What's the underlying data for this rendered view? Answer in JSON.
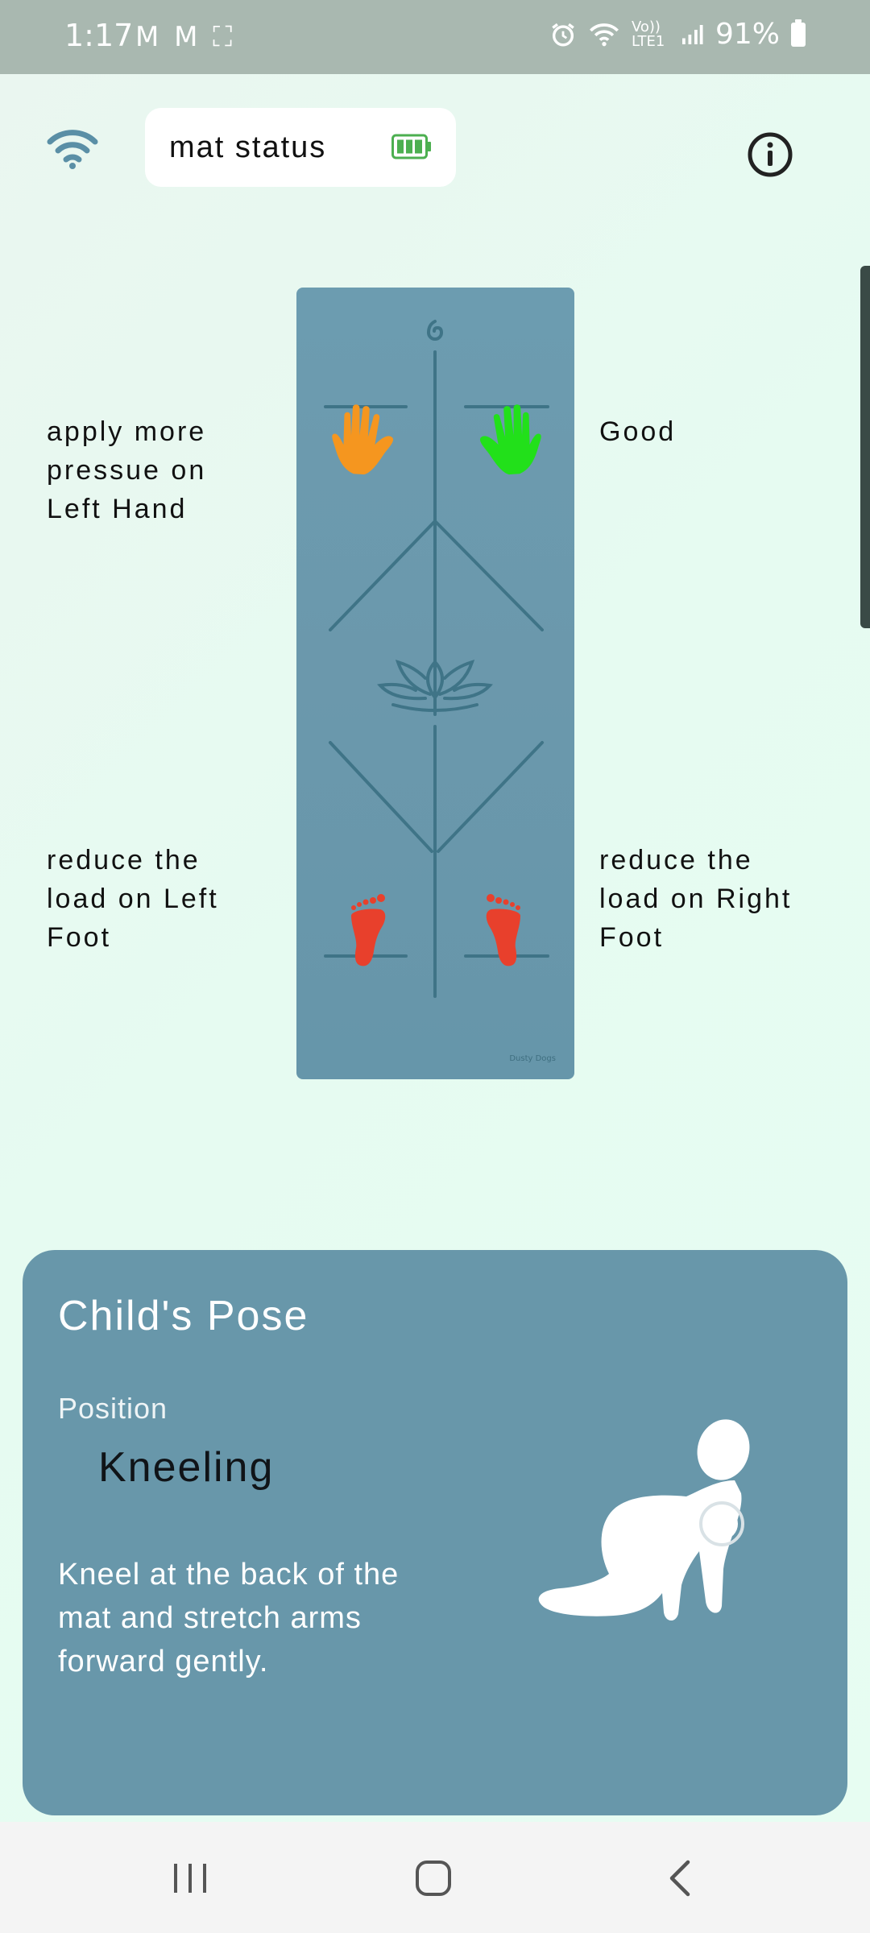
{
  "status_bar": {
    "time": "1:17",
    "left_icons": "M M ⛶",
    "volte": "Vo)) LTE1",
    "battery_pct": "91%"
  },
  "header": {
    "mat_status_label": "mat status",
    "battery_level": 1.0,
    "battery_color": "#4caf50"
  },
  "mat": {
    "left_hand": {
      "label": "apply more\npressue on\nLeft Hand",
      "color": "#f5961f"
    },
    "right_hand": {
      "label": "Good",
      "color": "#22e01a"
    },
    "left_foot": {
      "label": "reduce the\nload on Left\nFoot",
      "color": "#e8402c"
    },
    "right_foot": {
      "label": "reduce the\nload on Right\nFoot",
      "color": "#e8402c"
    },
    "brand": "Dusty Dogs"
  },
  "pose": {
    "title": "Child's Pose",
    "position_label": "Position",
    "position_value": "Kneeling",
    "description": "Kneel at the back of the mat and stretch arms forward gently."
  },
  "icons": {
    "wifi": "wifi-icon",
    "info": "info-icon",
    "battery": "battery-icon",
    "nav_recent": "recent-apps-icon",
    "nav_home": "home-icon",
    "nav_back": "back-icon"
  },
  "colors": {
    "card_bg": "#6897aa",
    "mat_bg": "#6c9cb0",
    "accent_wifi": "#5a8fa6"
  }
}
